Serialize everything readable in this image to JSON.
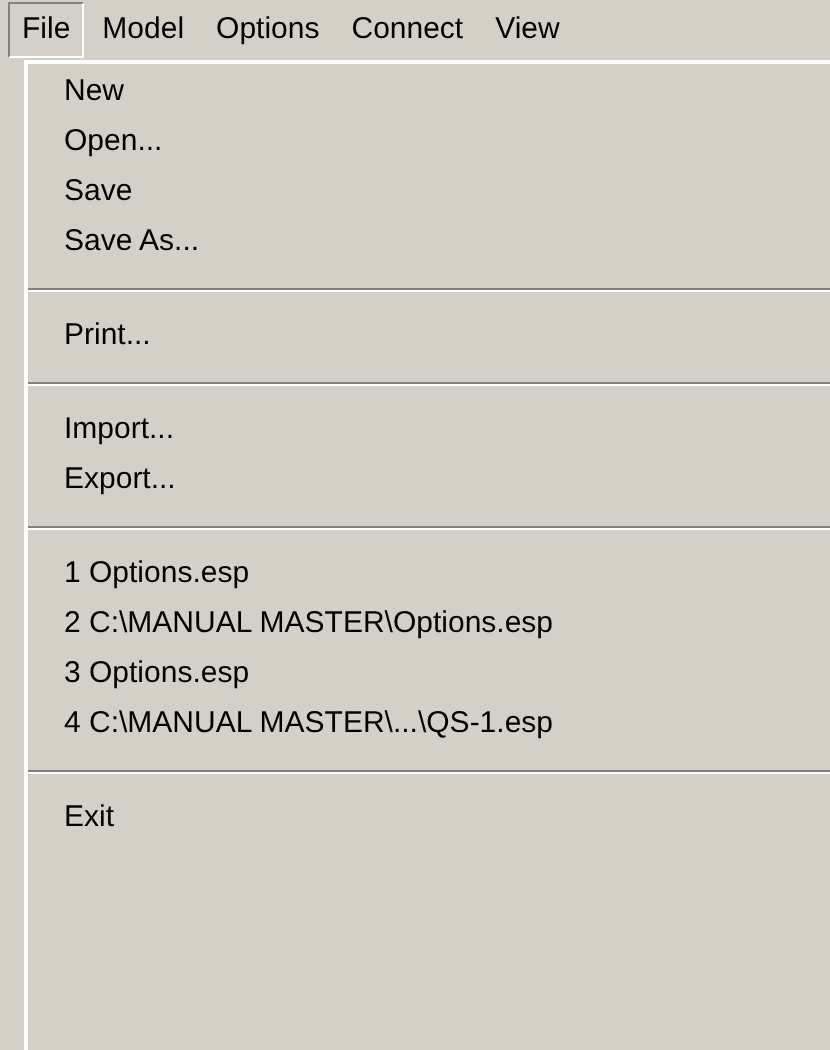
{
  "menu_bar": [
    {
      "label": "File",
      "selected": true
    },
    {
      "label": "Model",
      "selected": false
    },
    {
      "label": "Options",
      "selected": false
    },
    {
      "label": "Connect",
      "selected": false
    },
    {
      "label": "View",
      "selected": false
    }
  ],
  "file_menu": [
    {
      "kind": "item",
      "label": "New"
    },
    {
      "kind": "item",
      "label": "Open..."
    },
    {
      "kind": "item",
      "label": "Save"
    },
    {
      "kind": "item",
      "label": "Save As..."
    },
    {
      "kind": "separator"
    },
    {
      "kind": "item",
      "label": "Print..."
    },
    {
      "kind": "separator"
    },
    {
      "kind": "item",
      "label": "Import..."
    },
    {
      "kind": "item",
      "label": "Export..."
    },
    {
      "kind": "separator"
    },
    {
      "kind": "item",
      "label": "1 Options.esp"
    },
    {
      "kind": "item",
      "label": "2 C:\\MANUAL MASTER\\Options.esp"
    },
    {
      "kind": "item",
      "label": "3 Options.esp"
    },
    {
      "kind": "item",
      "label": "4 C:\\MANUAL MASTER\\...\\QS-1.esp"
    },
    {
      "kind": "separator"
    },
    {
      "kind": "item",
      "label": "Exit"
    }
  ]
}
